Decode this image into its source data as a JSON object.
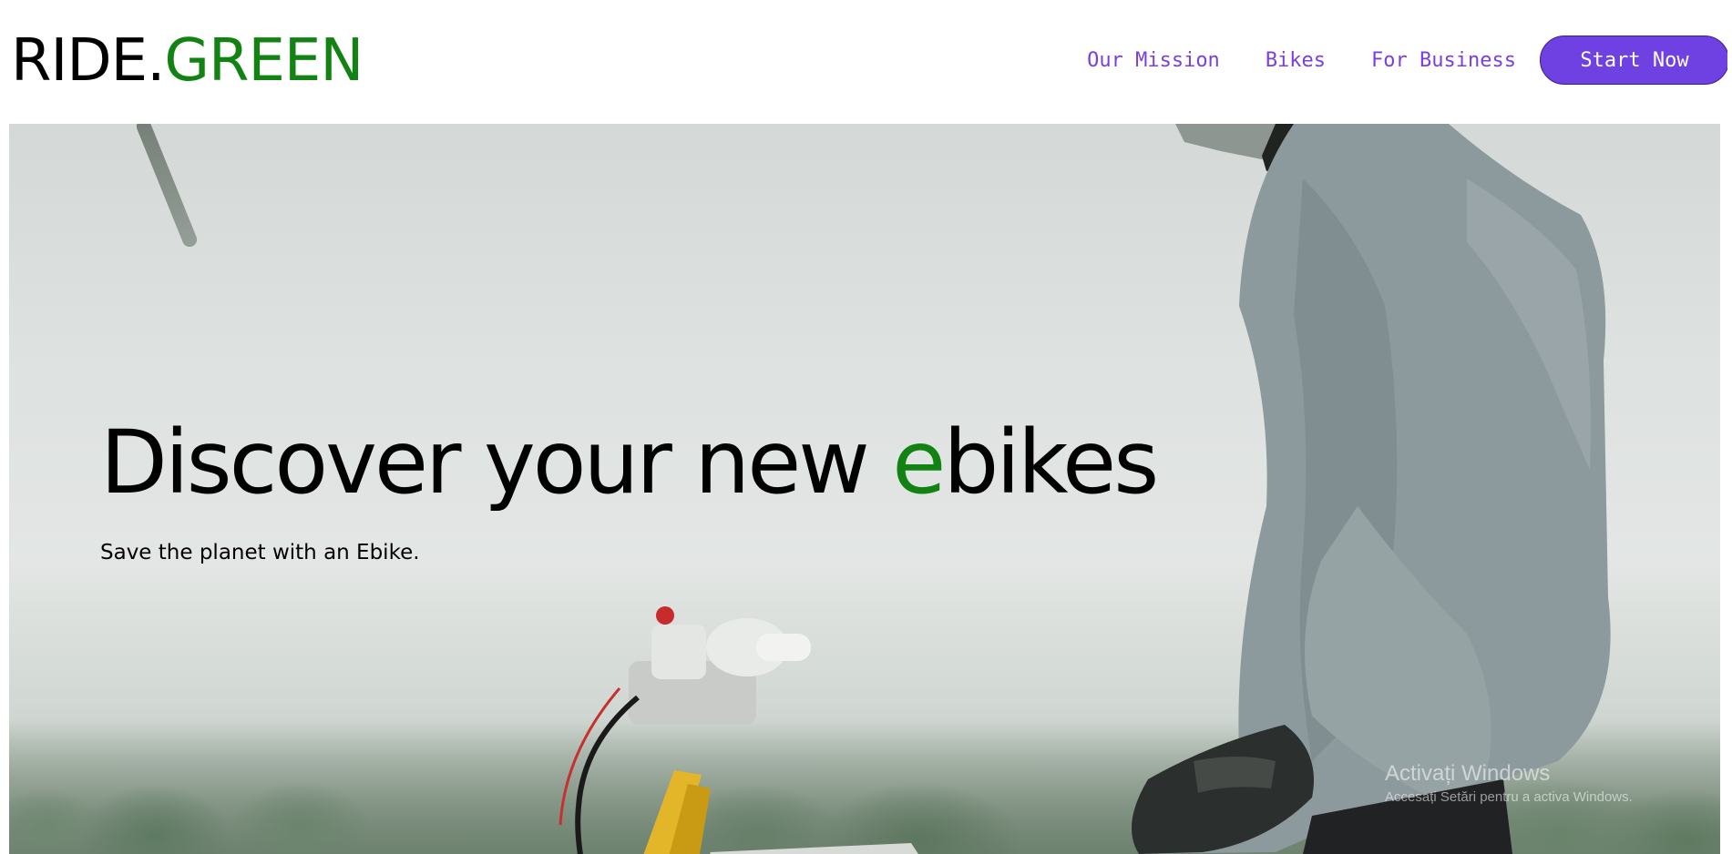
{
  "header": {
    "logo_prefix": "RIDE.",
    "logo_accent": "GREEN",
    "nav": [
      {
        "label": "Our Mission"
      },
      {
        "label": "Bikes"
      },
      {
        "label": "For Business"
      }
    ],
    "cta_label": "Start Now"
  },
  "hero": {
    "title_before": "Discover your new ",
    "title_accent": "e",
    "title_after": "bikes",
    "subtitle": "Save the planet with an Ebike."
  },
  "watermark": {
    "title": "Activați Windows",
    "subtitle": "Accesați Setări pentru a activa Windows."
  },
  "colors": {
    "brand_green": "#128212",
    "accent_purple": "#6f40e2",
    "nav_text": "#7b3fe0"
  }
}
